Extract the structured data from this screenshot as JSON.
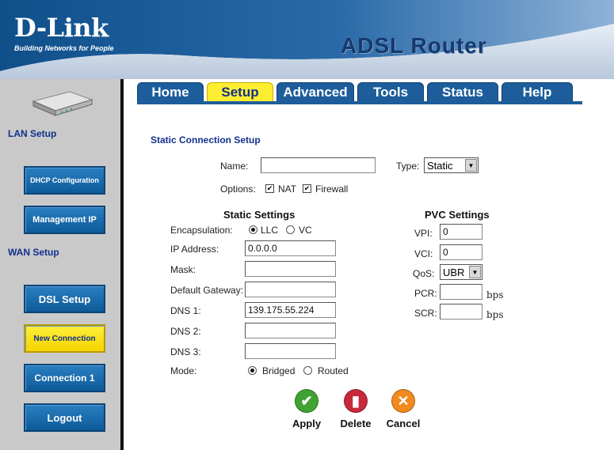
{
  "header": {
    "brand": "D-Link",
    "tagline": "Building Networks for People",
    "product": "ADSL Router"
  },
  "tabs": [
    {
      "label": "Home",
      "active": false
    },
    {
      "label": "Setup",
      "active": true
    },
    {
      "label": "Advanced",
      "active": false
    },
    {
      "label": "Tools",
      "active": false
    },
    {
      "label": "Status",
      "active": false
    },
    {
      "label": "Help",
      "active": false
    }
  ],
  "sidebar": {
    "lan_heading": "LAN Setup",
    "wan_heading": "WAN Setup",
    "buttons": {
      "dhcp": "DHCP Configuration",
      "management_ip": "Management IP",
      "dsl_setup": "DSL Setup",
      "new_connection": "New Connection",
      "connection1": "Connection 1",
      "logout": "Logout"
    }
  },
  "form": {
    "title": "Static Connection Setup",
    "name_label": "Name:",
    "name_value": "",
    "type_label": "Type:",
    "type_value": "Static",
    "options_label": "Options:",
    "nat_label": "NAT",
    "nat_checked": true,
    "firewall_label": "Firewall",
    "firewall_checked": true,
    "static_settings": {
      "title": "Static Settings",
      "encapsulation_label": "Encapsulation:",
      "llc_label": "LLC",
      "vc_label": "VC",
      "encapsulation_value": "LLC",
      "ip_label": "IP Address:",
      "ip_value": "0.0.0.0",
      "mask_label": "Mask:",
      "mask_value": "",
      "gateway_label": "Default Gateway:",
      "gateway_value": "",
      "dns1_label": "DNS 1:",
      "dns1_value": "139.175.55.224",
      "dns2_label": "DNS 2:",
      "dns2_value": "",
      "dns3_label": "DNS 3:",
      "dns3_value": "",
      "mode_label": "Mode:",
      "bridged_label": "Bridged",
      "routed_label": "Routed",
      "mode_value": "Bridged"
    },
    "pvc_settings": {
      "title": "PVC Settings",
      "vpi_label": "VPI:",
      "vpi_value": "0",
      "vci_label": "VCI:",
      "vci_value": "0",
      "qos_label": "QoS:",
      "qos_value": "UBR",
      "pcr_label": "PCR:",
      "pcr_value": "",
      "scr_label": "SCR:",
      "scr_value": "",
      "bps_unit": "bps"
    }
  },
  "actions": {
    "apply": "Apply",
    "delete": "Delete",
    "cancel": "Cancel"
  },
  "colors": {
    "brand_blue": "#1d5d9b",
    "active_tab": "#ffee30",
    "heading_blue": "#10308e"
  }
}
